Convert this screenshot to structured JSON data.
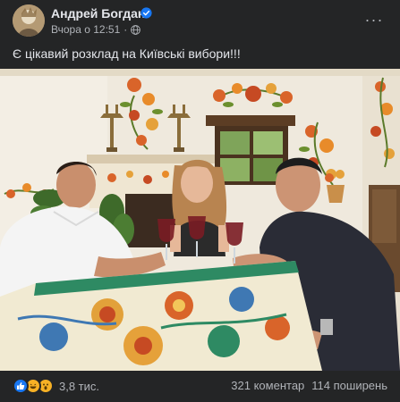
{
  "post": {
    "author": "Андрей Богдан",
    "time": "Вчора о 12:51",
    "dot": "·",
    "text": "Є цікавий розклад на Київські вибори!!!",
    "more_label": "···"
  },
  "photo": {
    "alt": "Three people sitting at a painted ceramic table raising glasses of red wine in a room decorated with Petrykivka folk flower paintings"
  },
  "footer": {
    "reaction_icons": [
      "like-icon",
      "haha-icon",
      "wow-icon"
    ],
    "reaction_count": "3,8 тис.",
    "comments": "321 коментар",
    "shares": "114 поширень"
  },
  "colors": {
    "background": "#242526",
    "text_primary": "#e4e6eb",
    "text_secondary": "#b0b3b8",
    "verified": "#1877f2"
  }
}
